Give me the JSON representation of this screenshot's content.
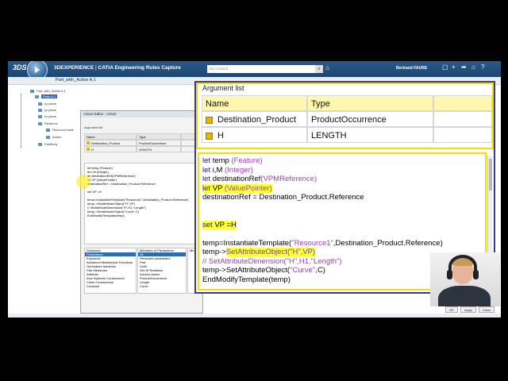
{
  "topbar": {
    "brand_logo": "3DS",
    "brand": "3DEXPERIENCE",
    "separator": " | ",
    "app_name": "CATIA Engineering Rules Capture",
    "search_placeholder": "My Content",
    "search_icon": "search-icon",
    "user": "Bertrand FAURE"
  },
  "document": {
    "title": "Part_with_Action A.1"
  },
  "tree": {
    "root": "Part_with_Action A.1",
    "items": [
      "Parts A.1",
      "xy plane",
      "yz plane",
      "zx plane",
      "Relations",
      "Resource table",
      "Action",
      "PartBody"
    ]
  },
  "action_editor": {
    "title": "Action Editor : Action",
    "argument_list_label": "Argument list",
    "columns": [
      "Name",
      "Type"
    ],
    "rows": [
      {
        "name": "Destination_Product",
        "type": "ProductOccurrence"
      },
      {
        "name": "H",
        "type": "LENGTH"
      }
    ],
    "code": [
      "let temp (Feature)",
      "let i,M (Integer)",
      "let destinationRef(VPMReference)",
      "let VP (ValuePointer)",
      "destinationRef = Destination_Product.Reference",
      "",
      "set VP =H",
      "",
      "temp=InstantiateTemplate(\"Resource1\",Destination_Product.Reference)",
      "temp->SetAttributeObject(\"H\",VP)",
      "// SetAttributeDimension(\"H\",H1,\"Length\")",
      "temp->SetAttributeObject(\"Curve\",C)",
      "EndModifyTemplate(temp)"
    ],
    "dictionary_header": "Dictionary",
    "dictionary": [
      "Parameters",
      "Keywords",
      "Advanced Mathematic Functions",
      "Generative functions",
      "Part Measures",
      "Attribute",
      "Axis Systems Constructors",
      "Circle Constructors",
      "Constant"
    ],
    "members_header": "Members of Parameters",
    "members": [
      "All",
      "Renamed parameters",
      "Part",
      "Solid",
      "Set Of Relations",
      "Advisor Action",
      "ProductOccurrence",
      "Length",
      "Curve"
    ],
    "members_3_header": "Me"
  },
  "zoom": {
    "argument_list_label": "Argument list",
    "columns": [
      "Name",
      "Type",
      ""
    ],
    "rows": [
      {
        "name": "Destination_Product",
        "type": "ProductOccurrence"
      },
      {
        "name": "H",
        "type": "LENGTH"
      }
    ],
    "code": {
      "l1a": "let ",
      "l1b": "temp ",
      "l1c": "(Feature)",
      "l2a": "let ",
      "l2b": "i,M ",
      "l2c": "(Integer)",
      "l3a": "let ",
      "l3b": "destinationRef",
      "l3c": "(VPMReference)",
      "l4a": "let ",
      "l4b": "VP ",
      "l4c": "(ValuePointer)",
      "l5": "destinationRef = Destination_Product.Reference",
      "l6a": "set ",
      "l6b": "VP =H",
      "l7a": "temp=InstantiateTemplate(",
      "l7b": "\"Resource1\"",
      "l7c": ",Destination_Product.Reference)",
      "l8a": "temp->",
      "l8b": "SetAttributeObject(\"H\",VP)",
      "l9": "// SetAttributeDimension(\"H\",H1,\"Length\")",
      "l10a": "temp->SetAttributeObject(",
      "l10b": "\"Curve\"",
      "l10c": ",C)",
      "l11": "EndModifyTemplate(temp)"
    }
  },
  "dialog": {
    "ok": "OK",
    "apply": "Apply",
    "close": "Close"
  },
  "colors": {
    "topbar": "#1d4670",
    "highlight": "#ffff3a",
    "border_yellow": "#f0e000",
    "keyword": "#1a1a8c",
    "type": "#9a3fb0"
  }
}
